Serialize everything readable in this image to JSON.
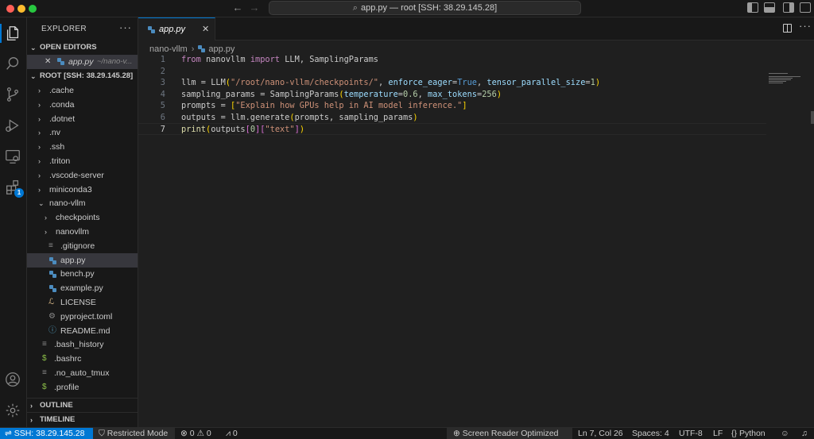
{
  "titlebar": {
    "command_center": "app.py — root [SSH: 38.29.145.28]"
  },
  "activity_bar": {
    "items": [
      "explorer-icon",
      "search-icon",
      "source-control-icon",
      "run-debug-icon",
      "remote-explorer-icon",
      "extensions-icon"
    ],
    "extensions_badge": "1",
    "bottom": [
      "account-icon",
      "manage-gear-icon"
    ]
  },
  "sidebar": {
    "title": "EXPLORER",
    "more": "···",
    "open_editors": {
      "header": "OPEN EDITORS",
      "items": [
        {
          "name": "app.py",
          "path": "~/nano-v..."
        }
      ]
    },
    "root": {
      "header": "ROOT [SSH: 38.29.145.28]",
      "items": [
        {
          "label": ".cache",
          "type": "folder",
          "depth": 0,
          "expanded": false
        },
        {
          "label": ".conda",
          "type": "folder",
          "depth": 0,
          "expanded": false
        },
        {
          "label": ".dotnet",
          "type": "folder",
          "depth": 0,
          "expanded": false
        },
        {
          "label": ".nv",
          "type": "folder",
          "depth": 0,
          "expanded": false
        },
        {
          "label": ".ssh",
          "type": "folder",
          "depth": 0,
          "expanded": false
        },
        {
          "label": ".triton",
          "type": "folder",
          "depth": 0,
          "expanded": false
        },
        {
          "label": ".vscode-server",
          "type": "folder",
          "depth": 0,
          "expanded": false
        },
        {
          "label": "miniconda3",
          "type": "folder",
          "depth": 0,
          "expanded": false
        },
        {
          "label": "nano-vllm",
          "type": "folder",
          "depth": 0,
          "expanded": true
        },
        {
          "label": "checkpoints",
          "type": "folder",
          "depth": 1,
          "expanded": false
        },
        {
          "label": "nanovllm",
          "type": "folder",
          "depth": 1,
          "expanded": false
        },
        {
          "label": ".gitignore",
          "type": "gitignore",
          "depth": 1
        },
        {
          "label": "app.py",
          "type": "python",
          "depth": 1,
          "selected": true
        },
        {
          "label": "bench.py",
          "type": "python",
          "depth": 1
        },
        {
          "label": "example.py",
          "type": "python",
          "depth": 1
        },
        {
          "label": "LICENSE",
          "type": "license",
          "depth": 1
        },
        {
          "label": "pyproject.toml",
          "type": "gear",
          "depth": 1
        },
        {
          "label": "README.md",
          "type": "info",
          "depth": 1
        },
        {
          "label": ".bash_history",
          "type": "lines",
          "depth": 0
        },
        {
          "label": ".bashrc",
          "type": "dollar",
          "depth": 0
        },
        {
          "label": ".no_auto_tmux",
          "type": "lines",
          "depth": 0
        },
        {
          "label": ".profile",
          "type": "dollar",
          "depth": 0
        }
      ]
    },
    "outline": "OUTLINE",
    "timeline": "TIMELINE"
  },
  "editor": {
    "tab": {
      "label": "app.py",
      "close": "✕"
    },
    "breadcrumb": [
      "nano-vllm",
      "app.py"
    ],
    "current_line": 7,
    "lines": [
      [
        {
          "t": "from",
          "c": "kw"
        },
        {
          "t": " nanovllm ",
          "c": "plain"
        },
        {
          "t": "import",
          "c": "kw"
        },
        {
          "t": " LLM, SamplingParams",
          "c": "plain"
        }
      ],
      [],
      [
        {
          "t": "llm = LLM",
          "c": "plain"
        },
        {
          "t": "(",
          "c": "br1"
        },
        {
          "t": "\"/root/nano-vllm/checkpoints/\"",
          "c": "str"
        },
        {
          "t": ", ",
          "c": "plain"
        },
        {
          "t": "enforce_eager",
          "c": "param"
        },
        {
          "t": "=",
          "c": "plain"
        },
        {
          "t": "True",
          "c": "bool"
        },
        {
          "t": ", ",
          "c": "plain"
        },
        {
          "t": "tensor_parallel_size",
          "c": "param"
        },
        {
          "t": "=",
          "c": "plain"
        },
        {
          "t": "1",
          "c": "num"
        },
        {
          "t": ")",
          "c": "br1"
        }
      ],
      [
        {
          "t": "sampling_params = SamplingParams",
          "c": "plain"
        },
        {
          "t": "(",
          "c": "br1"
        },
        {
          "t": "temperature",
          "c": "param"
        },
        {
          "t": "=",
          "c": "plain"
        },
        {
          "t": "0.6",
          "c": "num"
        },
        {
          "t": ", ",
          "c": "plain"
        },
        {
          "t": "max_tokens",
          "c": "param"
        },
        {
          "t": "=",
          "c": "plain"
        },
        {
          "t": "256",
          "c": "num"
        },
        {
          "t": ")",
          "c": "br1"
        }
      ],
      [
        {
          "t": "prompts = ",
          "c": "plain"
        },
        {
          "t": "[",
          "c": "br1"
        },
        {
          "t": "\"Explain how GPUs help in AI model inference.\"",
          "c": "str"
        },
        {
          "t": "]",
          "c": "br1"
        }
      ],
      [
        {
          "t": "outputs = llm.generate",
          "c": "plain"
        },
        {
          "t": "(",
          "c": "br1"
        },
        {
          "t": "prompts, sampling_params",
          "c": "plain"
        },
        {
          "t": ")",
          "c": "br1"
        }
      ],
      [
        {
          "t": "print",
          "c": "fn"
        },
        {
          "t": "(",
          "c": "br1"
        },
        {
          "t": "outputs",
          "c": "plain"
        },
        {
          "t": "[",
          "c": "br2"
        },
        {
          "t": "0",
          "c": "num"
        },
        {
          "t": "]",
          "c": "br2"
        },
        {
          "t": "[",
          "c": "br2"
        },
        {
          "t": "\"text\"",
          "c": "str"
        },
        {
          "t": "]",
          "c": "br2"
        },
        {
          "t": ")",
          "c": "br1"
        }
      ]
    ]
  },
  "statusbar": {
    "remote": "SSH: 38.29.145.28",
    "restricted": "Restricted Mode",
    "errors": "0",
    "warnings": "0",
    "ports": "0",
    "screen_reader": "Screen Reader Optimized",
    "cursor": "Ln 7, Col 26",
    "spaces": "Spaces: 4",
    "encoding": "UTF-8",
    "eol": "LF",
    "language": "Python"
  },
  "colors": {
    "accent": "#0078d4",
    "background": "#1f1f1f",
    "sidebar": "#181818",
    "selection": "#37373d"
  }
}
